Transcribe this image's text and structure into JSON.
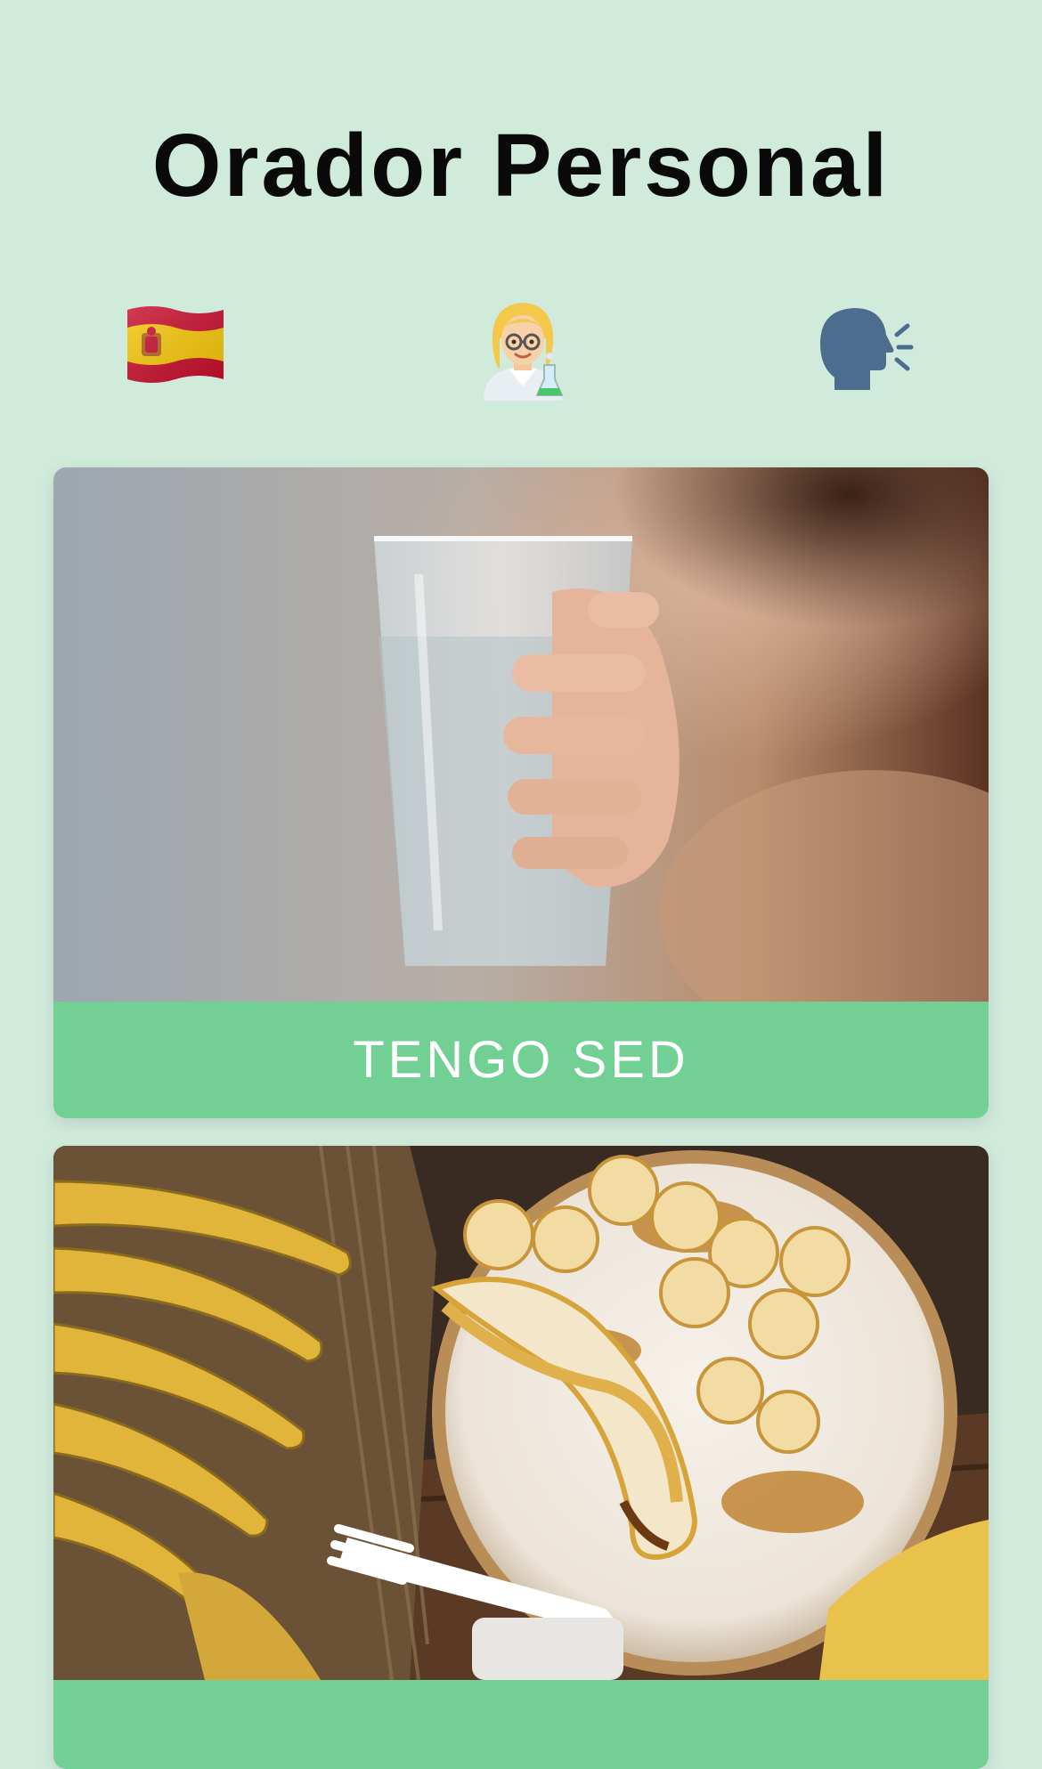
{
  "app": {
    "title": "Orador Personal"
  },
  "toolbar": {
    "language_icon": "spain-flag-icon",
    "voice_icon": "woman-scientist-icon",
    "speak_icon": "speaking-head-icon"
  },
  "colors": {
    "background": "#d0eadc",
    "card_label": "#72d095",
    "label_text": "#ffffff"
  },
  "phrases": [
    {
      "label": "TENGO SED",
      "image": "glass-of-water-photo"
    },
    {
      "label": "",
      "image": "bananas-plate-photo"
    }
  ]
}
